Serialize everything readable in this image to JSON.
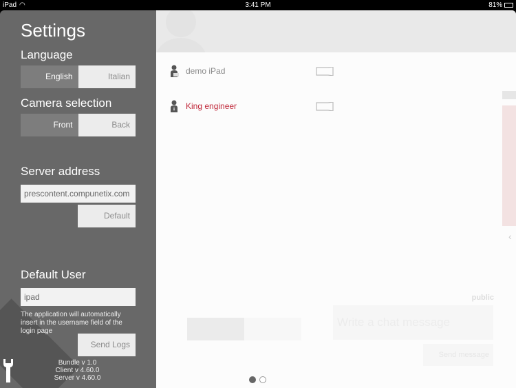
{
  "status_bar": {
    "device": "iPad",
    "time": "3:41 PM",
    "battery": "81%"
  },
  "settings": {
    "title": "Settings",
    "language": {
      "label": "Language",
      "options": [
        "English",
        "Italian"
      ],
      "selected": "English"
    },
    "camera": {
      "label": "Camera selection",
      "options": [
        "Front",
        "Back"
      ],
      "selected": "Front"
    },
    "server": {
      "label": "Server address",
      "value": "prescontent.compunetix.com",
      "default_button": "Default"
    },
    "default_user": {
      "label": "Default User",
      "value": "ipad",
      "note": "The application will automatically insert in the username field of the login page"
    },
    "send_logs": "Send Logs",
    "versions": [
      "Bundle v 1.0",
      "Client v 4.60.0",
      "Server v 4.60.0"
    ]
  },
  "participants": [
    {
      "name": "demo iPad",
      "color": "#8a8a8a",
      "icon": "user-ipad-icon"
    },
    {
      "name": "King engineer",
      "color": "#c0283a",
      "icon": "user-tie-icon"
    }
  ],
  "chat": {
    "channel": "public",
    "placeholder": "Write a chat message",
    "send_button": "Send message"
  },
  "pager": {
    "pages": 2,
    "current": 1
  }
}
